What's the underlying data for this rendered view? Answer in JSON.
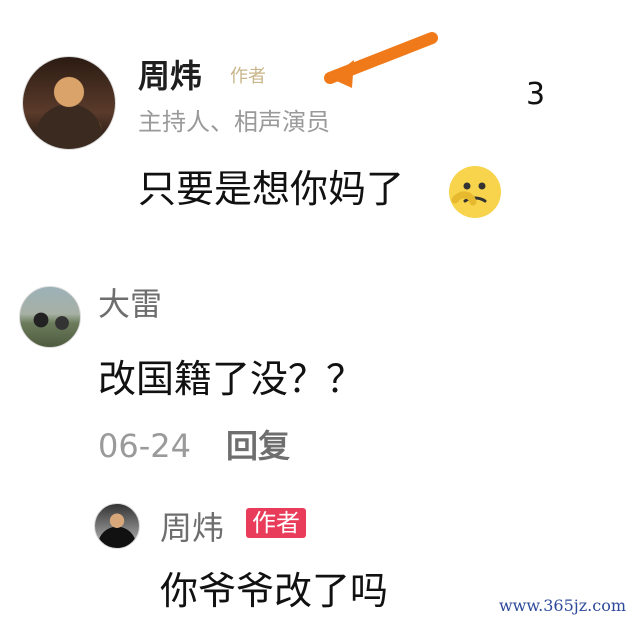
{
  "comment_thread": {
    "top_comment": {
      "author": "周炜",
      "author_tag": "作者",
      "author_subtitle": "主持人、相声演员",
      "likes": "3",
      "text": "只要是想你妈了"
    },
    "reply_comment": {
      "author": "大雷",
      "text": "改国籍了没？？",
      "date": "06-24",
      "reply_label": "回复"
    },
    "author_reply": {
      "author": "周炜",
      "author_tag": "作者",
      "text": "你爷爷改了吗"
    }
  },
  "watermark": "www.365jz.com",
  "colors": {
    "author_tag_red": "#e93b5a",
    "arrow_orange": "#f07a1a",
    "gray_text": "#9a9a9a"
  },
  "icons": {
    "emoji": "thinking-face-icon",
    "arrow": "orange-arrow-icon"
  }
}
